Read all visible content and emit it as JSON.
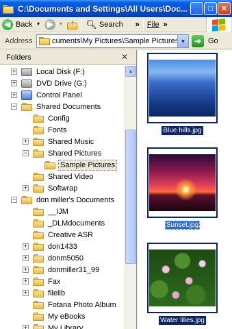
{
  "window": {
    "title": "C:\\Documents and Settings\\All Users\\Doc...",
    "min_glyph": "_",
    "max_glyph": "□",
    "close_glyph": "✕"
  },
  "toolbar": {
    "back_label": "Back",
    "search_label": "Search",
    "file_menu": "File",
    "chevron": "»"
  },
  "address": {
    "label": "Address",
    "value": "cuments\\My Pictures\\Sample Pictures",
    "go_label": "Go"
  },
  "folders": {
    "header": "Folders",
    "close_glyph": "✕",
    "items": [
      {
        "label": "Local Disk (F:)",
        "icon": "drive-icon",
        "expander": "+"
      },
      {
        "label": "DVD Drive (G:)",
        "icon": "dvd-drive-icon",
        "expander": "+"
      },
      {
        "label": "Control Panel",
        "icon": "control-panel-icon",
        "expander": "+"
      },
      {
        "label": "Shared Documents",
        "icon": "folder-icon",
        "expander": "−"
      },
      {
        "label": "Config",
        "icon": "folder-icon",
        "expander": ""
      },
      {
        "label": "Fonts",
        "icon": "folder-icon",
        "expander": ""
      },
      {
        "label": "Shared Music",
        "icon": "music-folder-icon",
        "expander": "+"
      },
      {
        "label": "Shared Pictures",
        "icon": "pictures-folder-icon",
        "expander": "−"
      },
      {
        "label": "Sample Pictures",
        "icon": "folder-open-icon",
        "expander": ""
      },
      {
        "label": "Shared Video",
        "icon": "video-folder-icon",
        "expander": ""
      },
      {
        "label": "Softwrap",
        "icon": "folder-icon",
        "expander": "+"
      },
      {
        "label": "don miller's Documents",
        "icon": "folder-icon",
        "expander": "−"
      },
      {
        "label": "__IJM",
        "icon": "folder-icon",
        "expander": ""
      },
      {
        "label": "_DLMdocuments",
        "icon": "folder-icon",
        "expander": ""
      },
      {
        "label": "Creative ASR",
        "icon": "folder-icon",
        "expander": ""
      },
      {
        "label": "don1433",
        "icon": "folder-icon",
        "expander": "+"
      },
      {
        "label": "donm5050",
        "icon": "folder-icon",
        "expander": "+"
      },
      {
        "label": "donmiller31_99",
        "icon": "folder-icon",
        "expander": "+"
      },
      {
        "label": "Fax",
        "icon": "folder-icon",
        "expander": "+"
      },
      {
        "label": "filelib",
        "icon": "folder-icon",
        "expander": "+"
      },
      {
        "label": "Fotana Photo Album",
        "icon": "folder-icon",
        "expander": ""
      },
      {
        "label": "My eBooks",
        "icon": "folder-icon",
        "expander": ""
      },
      {
        "label": "My Library",
        "icon": "folder-icon",
        "expander": "+"
      }
    ]
  },
  "thumbnails": [
    {
      "name": "Blue hills.jpg"
    },
    {
      "name": "Sunset.jpg"
    },
    {
      "name": "Water lilies.jpg"
    }
  ],
  "colors": {
    "titlebar": "#0054e3",
    "selection": "#0a246a"
  }
}
